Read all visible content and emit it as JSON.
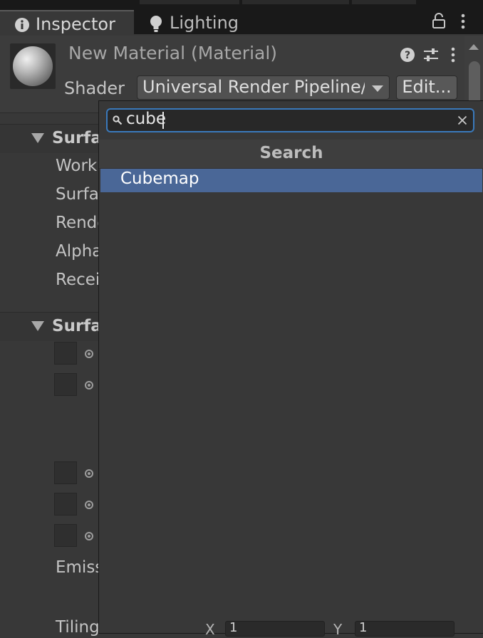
{
  "tabs": [
    {
      "label": "Inspector",
      "icon": "info-icon",
      "active": true
    },
    {
      "label": "Lighting",
      "icon": "bulb-icon",
      "active": false
    }
  ],
  "header": {
    "title": "New Material (Material)",
    "shader_label": "Shader",
    "shader_value": "Universal Render Pipeline/Lit",
    "edit_label": "Edit..."
  },
  "sections": [
    {
      "title": "Surface Options",
      "visible_text": "Surfa"
    },
    {
      "title": "Surface Inputs",
      "visible_text": "Surfa"
    }
  ],
  "properties": [
    "Work",
    "Surfa",
    "Rende",
    "Alpha",
    "Recei"
  ],
  "emission_label": "Emiss",
  "tiling": {
    "label": "Tiling",
    "x_label": "X",
    "x_value": "1",
    "y_label": "Y",
    "y_value": "1"
  },
  "popup": {
    "search_value": "cube",
    "header": "Search",
    "results": [
      {
        "label": "Cubemap",
        "selected": true
      }
    ]
  },
  "colors": {
    "accent": "#3a79bb",
    "selection": "#4a6797",
    "panel": "#383838"
  }
}
